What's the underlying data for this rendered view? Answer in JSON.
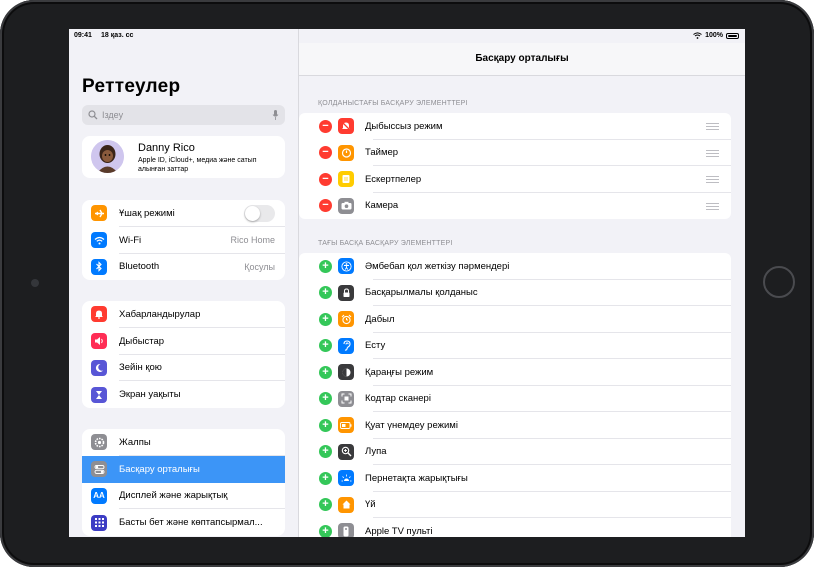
{
  "status": {
    "time": "09:41",
    "date": "18 қаз. сс",
    "battery": "100%"
  },
  "sidebar": {
    "title": "Реттеулер",
    "search_placeholder": "Іздеу",
    "profile": {
      "name": "Danny Rico",
      "subtitle": "Apple ID, iCloud+, медиа және сатып алынған заттар"
    },
    "group1": [
      {
        "label": "Ұшақ режимі",
        "icon": "airplane-icon",
        "color": "#ff9500",
        "toggle": "off"
      },
      {
        "label": "Wi-Fi",
        "value": "Rico Home",
        "icon": "wifi-icon",
        "color": "#007aff"
      },
      {
        "label": "Bluetooth",
        "value": "Қосулы",
        "icon": "bluetooth-icon",
        "color": "#007aff"
      }
    ],
    "group2": [
      {
        "label": "Хабарландырулар",
        "icon": "bell-icon",
        "color": "#ff3b30"
      },
      {
        "label": "Дыбыстар",
        "icon": "speaker-icon",
        "color": "#ff2d55"
      },
      {
        "label": "Зейін қою",
        "icon": "moon-icon",
        "color": "#5856d6"
      },
      {
        "label": "Экран уақыты",
        "icon": "hourglass-icon",
        "color": "#5856d6"
      }
    ],
    "group3": [
      {
        "label": "Жалпы",
        "icon": "gear-icon",
        "color": "#8e8e93"
      },
      {
        "label": "Басқару орталығы",
        "icon": "toggles-icon",
        "color": "#8e8e93",
        "selected": true
      },
      {
        "label": "Дисплей және жарықтық",
        "icon": "text-size-icon",
        "color": "#007aff"
      },
      {
        "label": "Басты бет және көптапсырмал...",
        "icon": "grid-icon",
        "color": "#3c3cc4"
      }
    ]
  },
  "main": {
    "title": "Басқару орталығы",
    "included_header": "ҚОЛДАНЫСТАҒЫ БАСҚАРУ ЭЛЕМЕНТТЕРІ",
    "included": [
      {
        "label": "Дыбыссыз режим",
        "icon": "bell-slash-icon",
        "color": "#ff3b30"
      },
      {
        "label": "Таймер",
        "icon": "timer-icon",
        "color": "#ff9500"
      },
      {
        "label": "Ескертпелер",
        "icon": "notes-icon",
        "color": "#ffcc00"
      },
      {
        "label": "Камера",
        "icon": "camera-icon",
        "color": "#8e8e93"
      }
    ],
    "more_header": "ТАҒЫ БАСҚА БАСҚАРУ ЭЛЕМЕНТТЕРІ",
    "more": [
      {
        "label": "Әмбебап қол жеткізу пәрмендері",
        "icon": "accessibility-icon",
        "color": "#007aff"
      },
      {
        "label": "Басқарылмалы қолданыс",
        "icon": "lock-icon",
        "color": "#3a3a3c"
      },
      {
        "label": "Дабыл",
        "icon": "alarm-icon",
        "color": "#ff9500"
      },
      {
        "label": "Есту",
        "icon": "ear-icon",
        "color": "#007aff"
      },
      {
        "label": "Қараңғы режим",
        "icon": "dark-mode-icon",
        "color": "#3a3a3c"
      },
      {
        "label": "Кодтар сканері",
        "icon": "qr-scanner-icon",
        "color": "#8e8e93"
      },
      {
        "label": "Қуат үнемдеу режимі",
        "icon": "battery-icon",
        "color": "#ff9500"
      },
      {
        "label": "Лупа",
        "icon": "magnifier-icon",
        "color": "#3a3a3c"
      },
      {
        "label": "Пернетақта жарықтығы",
        "icon": "keyboard-brightness-icon",
        "color": "#007aff"
      },
      {
        "label": "Үй",
        "icon": "home-icon",
        "color": "#ff9500"
      },
      {
        "label": "Apple TV пульті",
        "icon": "remote-icon",
        "color": "#8e8e93"
      }
    ]
  }
}
